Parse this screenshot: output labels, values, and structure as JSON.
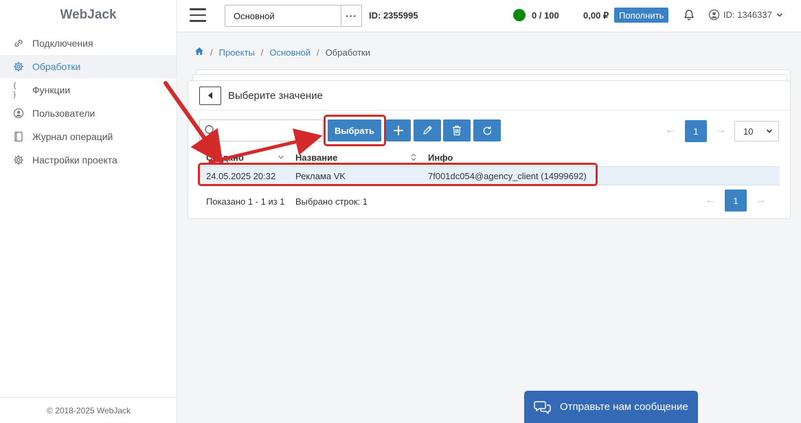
{
  "sidebar": {
    "logo": "WebJack",
    "items": [
      {
        "label": "Подключения",
        "icon": "link-icon"
      },
      {
        "label": "Обработки",
        "icon": "gear-icon"
      },
      {
        "label": "Функции",
        "icon": "braces-icon"
      },
      {
        "label": "Пользователи",
        "icon": "user-icon"
      },
      {
        "label": "Журнал операций",
        "icon": "journal-icon"
      },
      {
        "label": "Настройки проекта",
        "icon": "gear-icon"
      }
    ],
    "footer": "© 2018-2025 WebJack"
  },
  "header": {
    "project_select": "Основной",
    "more_label": "···",
    "project_id": "ID: 2355995",
    "limit": "0 / 100",
    "balance": "0,00 ₽",
    "topup_label": "Пополнить",
    "user_id": "ID: 1346337"
  },
  "breadcrumb": {
    "projects": "Проекты",
    "main": "Основной",
    "current": "Обработки",
    "sep": "/"
  },
  "panel": {
    "title": "Выберите значение",
    "select_label": "Выбрать",
    "search_placeholder": "",
    "page_top": "1",
    "per_page": "10",
    "prev_arrow": "←",
    "next_arrow": "→",
    "columns": {
      "created": "Создано",
      "name": "Название",
      "info": "Инфо"
    },
    "rows": [
      {
        "created": "24.05.2025 20:32",
        "name": "Реклама VK",
        "info": "7f001dc054@agency_client (14999692)"
      }
    ],
    "shown": "Показано 1 - 1 из 1",
    "selected": "Выбрано строк: 1",
    "page_bottom": "1"
  },
  "chat": {
    "label": "Отправьте нам сообщение"
  },
  "colors": {
    "accent": "#3b82c4",
    "highlight": "#d32a2a",
    "status": "#0a8a0a",
    "chat": "#3369b5"
  }
}
